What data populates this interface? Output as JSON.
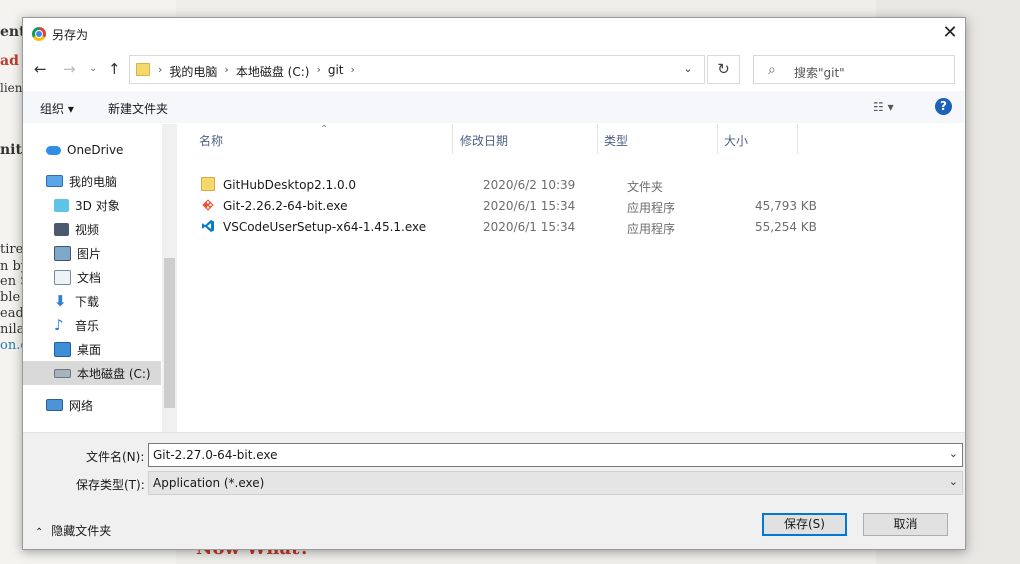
{
  "background": {
    "left_fragments": [
      "ent",
      "ad",
      "lien",
      "nit",
      "tire",
      "n by",
      "en S",
      "ble t",
      "ead",
      "nila",
      "on.c"
    ],
    "bottom_heading": "Now What?"
  },
  "dialog": {
    "title": "另存为",
    "close_label": "✕"
  },
  "address": {
    "crumbs": [
      "我的电脑",
      "本地磁盘 (C:)",
      "git"
    ],
    "separator": "›"
  },
  "search": {
    "placeholder": "搜索\"git\""
  },
  "toolbar": {
    "organize": "组织 ▾",
    "new_folder": "新建文件夹",
    "help": "?"
  },
  "nav_pane": {
    "items": [
      {
        "label": "OneDrive",
        "icon": "cloud-icon"
      },
      {
        "label": "我的电脑",
        "icon": "computer-icon"
      },
      {
        "label": "3D 对象",
        "icon": "cube-icon"
      },
      {
        "label": "视频",
        "icon": "video-icon"
      },
      {
        "label": "图片",
        "icon": "picture-icon"
      },
      {
        "label": "文档",
        "icon": "document-icon"
      },
      {
        "label": "下载",
        "icon": "download-icon"
      },
      {
        "label": "音乐",
        "icon": "music-icon"
      },
      {
        "label": "桌面",
        "icon": "desktop-icon"
      },
      {
        "label": "本地磁盘 (C:)",
        "icon": "drive-icon"
      },
      {
        "label": "网络",
        "icon": "network-icon"
      }
    ]
  },
  "columns": [
    "名称",
    "修改日期",
    "类型",
    "大小"
  ],
  "files": [
    {
      "name": "GitHubDesktop2.1.0.0",
      "date": "2020/6/2 10:39",
      "type": "文件夹",
      "size": "",
      "icon": "folder-icon"
    },
    {
      "name": "Git-2.26.2-64-bit.exe",
      "date": "2020/6/1 15:34",
      "type": "应用程序",
      "size": "45,793 KB",
      "icon": "git-icon"
    },
    {
      "name": "VSCodeUserSetup-x64-1.45.1.exe",
      "date": "2020/6/1 15:34",
      "type": "应用程序",
      "size": "55,254 KB",
      "icon": "vscode-icon"
    }
  ],
  "bottom": {
    "filename_label": "文件名(N):",
    "filename_value": "Git-2.27.0-64-bit.exe",
    "filetype_label": "保存类型(T):",
    "filetype_value": "Application (*.exe)",
    "hide_folders": "隐藏文件夹",
    "save_label": "保存(S)",
    "cancel_label": "取消"
  },
  "colors": {
    "accent": "#0078d7",
    "folder": "#f6d76b",
    "header_text": "#4d6082"
  }
}
